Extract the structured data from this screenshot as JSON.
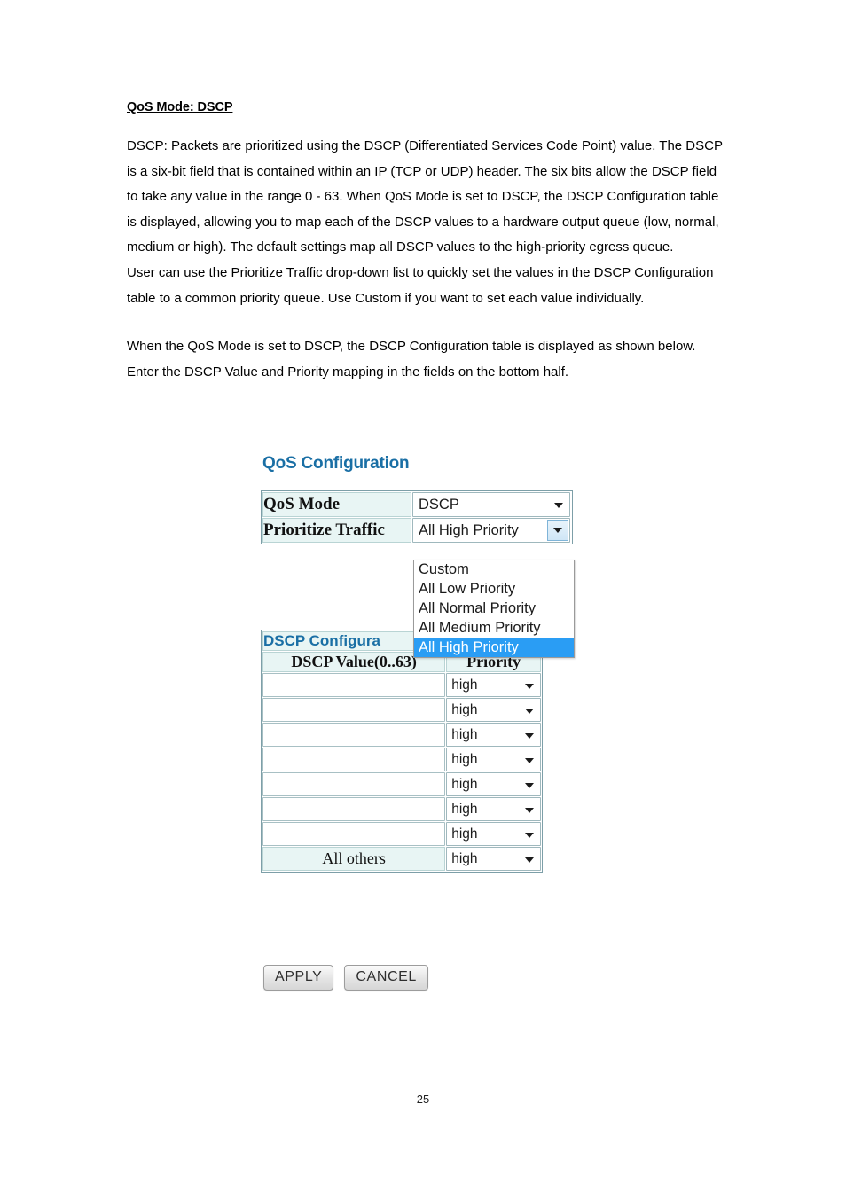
{
  "document": {
    "heading": "QoS Mode: DSCP",
    "paragraphs": [
      "DSCP: Packets are prioritized using the DSCP (Differentiated Services Code Point) value. The DSCP is a six-bit field that is contained within an IP (TCP or UDP) header. The six bits allow the DSCP field to take any value in the range 0 - 63. When QoS Mode is set to DSCP, the DSCP Configuration table is displayed, allowing you to map each of the DSCP values to a hardware output queue (low, normal, medium or high). The default settings map all DSCP values to the high-priority egress queue.",
      "User can use the Prioritize Traffic drop-down list to quickly set the values in the DSCP Configuration table to a common priority queue. Use Custom if you want to set each value individually.",
      "When the QoS Mode is set to DSCP, the DSCP Configuration table is displayed as shown below. Enter the DSCP Value and Priority mapping in the fields on the bottom half."
    ],
    "page_number": "25"
  },
  "webui": {
    "title": "QoS Configuration",
    "qos_form": {
      "rows": [
        {
          "label": "QoS Mode",
          "value": "DSCP"
        },
        {
          "label": "Prioritize Traffic",
          "value": "All High Priority"
        }
      ]
    },
    "prioritize_dropdown": {
      "open": true,
      "selected": "All High Priority",
      "options": [
        "Custom",
        "All Low Priority",
        "All Normal Priority",
        "All Medium Priority",
        "All High Priority"
      ],
      "highlight_color": "#2a9df4"
    },
    "dscp_table": {
      "banner": "DSCP Configuration",
      "banner_visible_text": "DSCP Configura",
      "columns": [
        "DSCP Value(0..63)",
        "Priority"
      ],
      "rows": [
        {
          "value": "",
          "priority": "high"
        },
        {
          "value": "",
          "priority": "high"
        },
        {
          "value": "",
          "priority": "high"
        },
        {
          "value": "",
          "priority": "high"
        },
        {
          "value": "",
          "priority": "high"
        },
        {
          "value": "",
          "priority": "high"
        },
        {
          "value": "",
          "priority": "high"
        }
      ],
      "all_others_row": {
        "label": "All others",
        "priority": "high"
      }
    },
    "buttons": {
      "apply": "APPLY",
      "cancel": "CANCEL"
    },
    "colors": {
      "heading_blue": "#1a6fa5",
      "label_bg": "#e8f5f4",
      "border": "#b9d4d4"
    }
  }
}
